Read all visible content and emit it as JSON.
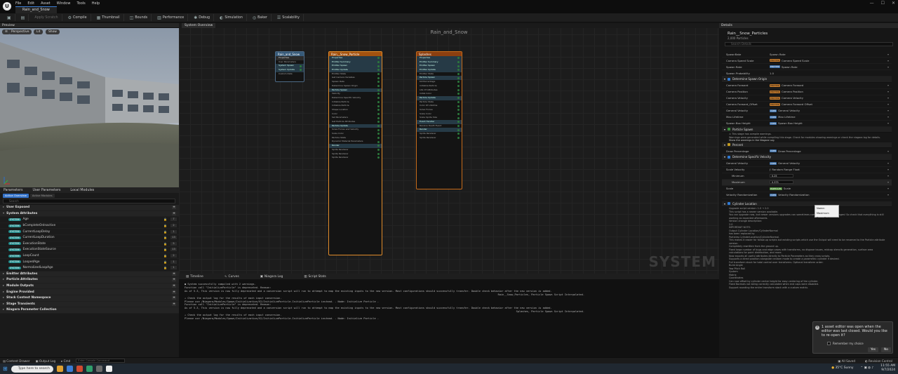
{
  "titlebar": {
    "menu": [
      "File",
      "Edit",
      "Asset",
      "Window",
      "Tools",
      "Help"
    ],
    "tab": "Rain_and_Snow",
    "window_controls": [
      "—",
      "☐",
      "✕"
    ]
  },
  "toolbar": {
    "apply": "Apply Scratch",
    "compile": "Compile",
    "thumbnail": "Thumbnail",
    "bounds": "Bounds",
    "performance": "Performance",
    "debug": "Debug",
    "simulation": "Simulation",
    "baker": "Baker",
    "scalability": "Scalability"
  },
  "preview": {
    "title": "Preview",
    "perspective": "Perspective",
    "lit": "Lit",
    "show": "Show"
  },
  "parameters": {
    "tabs": [
      "Parameters",
      "User Parameters",
      "Local Modules"
    ],
    "subtabs": [
      "Active Overview",
      "Active Modules"
    ],
    "search_placeholder": "Search",
    "user_exposed": "User Exposed",
    "system_attributes": "System Attributes",
    "system_pill": "SYSTEM",
    "attrs": [
      {
        "name": "Age",
        "count": "7"
      },
      {
        "name": "bCompleteOnInactive",
        "count": "2"
      },
      {
        "name": "CurrentLoopDelay",
        "count": "1"
      },
      {
        "name": "CurrentLoopDuration",
        "count": "13"
      },
      {
        "name": "ExecutionState",
        "count": "5"
      },
      {
        "name": "ExecutionStateSource",
        "count": "13"
      },
      {
        "name": "LoopCount",
        "count": "2"
      },
      {
        "name": "LoopedAge",
        "count": "1"
      },
      {
        "name": "NormalizedLoopAge",
        "count": "1"
      }
    ],
    "categories": [
      "Emitter Attributes",
      "Particle Attributes",
      "Module Outputs",
      "Engine Provided",
      "Stack Context Namespace",
      "Stage Transients",
      "Niagara Parameter Collection"
    ]
  },
  "graph": {
    "tab": "System Overview",
    "title": "Rain_and_Snow",
    "watermark": "SYSTEM",
    "sys_node": {
      "title": "Rain_and_Snow",
      "rows": [
        "Properties",
        "User Parameters",
        "System Spawn",
        "System Update",
        "Custom Data"
      ]
    },
    "rain_node": {
      "title": "Rain__Snow_Particle",
      "rows": [
        "Properties",
        "Emitter Summary",
        "Emitter Spawn",
        "Emitter Update",
        "Emitter State",
        "Get Camera Variables",
        "Spawn Rate",
        "Determine Spawn Origin",
        "Particle Spawn",
        "Velocity",
        "Determine Specific Velocity",
        "Initialize Particle",
        "Initialize Particle",
        "Shape Location",
        "Color",
        "Set Parameters",
        "Get Particle Attributes",
        "Particle Update",
        "Solve Forces and Velocity",
        "Scale Color",
        "Particle State",
        "Dynamic Material Parameters",
        "Render",
        "Sprite Renderer",
        "Sprite Renderer",
        "Sprite Renderer"
      ]
    },
    "splash_node": {
      "title": "Splashes",
      "rows": [
        "Properties",
        "Emitter Summary",
        "Emitter Spawn",
        "Emitter Update",
        "Emitter State",
        "Particle Spawn",
        "Kill Percentage",
        "Initialize Particle",
        "Life Of Attributes",
        "Initial Color",
        "Particle Update",
        "Particle State",
        "Color Of Lifetime",
        "Solve Forces",
        "Scale Color",
        "Scale Sprite Size",
        "Event Handler",
        "Receive Death Event",
        "Render",
        "Sprite Renderer",
        "Sprite Renderer"
      ]
    }
  },
  "bottom": {
    "tabs": [
      "Timeline",
      "Curves",
      "Niagara Log",
      "Script Stats"
    ],
    "log": [
      "● System successfully compiled with 2 warnings.",
      "  Function call \"InitializeParticle\" is deprecated. Reason:",
      "  As of 5.3, This version is now fully deprecated and a conversion script will run to attempt to map the existing inputs to the new version. Most configurations should successfully transfer. Double check behavior after the new version is added.",
      "Rain__Snow_Particles, Particle Spawn Script Interpolated.",
      "⚠ Check the output log for the results of each input conversion.",
      "  Please use /Niagara/Modules/Spawn/Initialization/V2/InitializeParticle.InitializeParticle instead. - Node: Initialize Particle -",
      "  Function call \"InitializeParticle\" is deprecated. Reason:",
      "  As of 5.3, This version is now fully deprecated and a conversion script will run to attempt to map the existing inputs to the new version. Most configurations should successfully transfer. Double check behavior after the new version is added.",
      "Splashes, Particle Spawn Script Interpolated.",
      "⚠ Check the output log for the results of each input conversion.",
      "  Please use /Niagara/Modules/Spawn/Initialization/V2/InitializeParticle.InitializeParticle instead. - Node: Initialize Particle -"
    ]
  },
  "details": {
    "tab": "Details",
    "title": "Rain__Snow_Particles",
    "count": "2,000 Particles",
    "search_placeholder": "Search Details",
    "spawn_rate_rows": [
      {
        "label": "SpawnRate",
        "pill": "",
        "value": "Spawn Rate"
      },
      {
        "label": "Camera Speed Scale",
        "pill": "EMITTER",
        "value": "Camera Speed Scale"
      },
      {
        "label": "Spawn Rate",
        "pill": "EMITTER",
        "value": "Spawn Rate"
      },
      {
        "label": "Spawn Probability",
        "pill": "",
        "value": "1.0"
      }
    ],
    "origin_section": "Determine Spawn Origin",
    "origin_rows": [
      {
        "label": "Camera Forward",
        "value": "Camera Forward"
      },
      {
        "label": "Camera Position",
        "value": "Camera Position"
      },
      {
        "label": "Camera Velocity",
        "value": "Camera Velocity"
      },
      {
        "label": "Camera Forward_Offset",
        "value": "Camera Forward Offset"
      },
      {
        "label": "General Velocity",
        "value": "General Velocity"
      },
      {
        "label": "Max Lifetime",
        "value": "Max Lifetime"
      },
      {
        "label": "Spawn Box Height",
        "value": "Spawn Box Height"
      }
    ],
    "particle_spawn": "Particle Spawn",
    "warn_text_1": "This stage has compile warnings.",
    "warn_text_2": "Warnings were generated while compiling this stage. Check for modules showing warnings or check the niagara log for details.",
    "warn_link": "Show the warnings in the Niagara Log",
    "percent_section": "Percent",
    "percent_row": {
      "label": "Draw Percentage",
      "value": "Draw Percentage"
    },
    "velocity_section": "Determine Specific Velocity",
    "velocity_rows": [
      {
        "label": "General Velocity",
        "value": "General Velocity"
      },
      {
        "label": "Scale Velocity",
        "value": "Random Range Float"
      },
      {
        "label": "Minimum",
        "value": "0.25"
      },
      {
        "label": "Maximum",
        "value": "0.375"
      },
      {
        "label": "Scale",
        "value": "Scale"
      },
      {
        "label": "Velocity Randomization",
        "value": "Velocity Randomization"
      }
    ],
    "tooltip_name": "Name: Maximum",
    "tooltip_type": "Type: float",
    "cylinder_section": "Cylinder Location",
    "cylinder_text": [
      "Upgrade script version: 1.0 → 2.0",
      "This script has a newer version available.",
      "You can upgrade now, but newer versions upgrades can sometimes come with breaking changes! So check that everything is still working as expected afterwards.",
      "Version change description:",
      "2.0",
      "IMPORTANT NOTE:",
      "Output Cylinder Location/CylinderNormal",
      "has been replaced by",
      "Particles.CylinderLocation/CylinderNormal.",
      "This makes it easier for follow-up scripts but existing scripts which use the Output will need to be renamed to the Particle attribute version.",
      "Completely rewritten from the ground up.",
      "Fixed large number of bugs and edge cases with transforms, no dispose issues, midcap stencils generation, surface area calculations for point distribution, and more.",
      "Now exports all useful attributes directly to Particle Parameters as they cross scripts.",
      "Supports a direct position alongside random mode to create a parametric cylinder if desired.",
      "Full transform stack for total control over transforms. Optional transform order:",
      "Burst Angle",
      "Yaw Pitch Roll",
      "System",
      "Matrix",
      "Coordinates",
      "Can now offset by cylinder center height for easy centering of the cylinder.",
      "Fixed Normals not being correctly calculated when end caps were disabled.",
      "Support rounding the entire transform stack with a custom matrix."
    ]
  },
  "toast": {
    "message": "1 asset editor was open when the editor was last closed. Would you like to re-open it?",
    "remember": "Remember my choice",
    "yes": "Yes",
    "no": "No"
  },
  "status": {
    "content_drawer": "Content Drawer",
    "output_log": "Output Log",
    "cmd": "Cmd",
    "cmd_placeholder": "Enter Console Command",
    "all_saved": "All Saved",
    "revision": "Revision Control"
  },
  "taskbar": {
    "search": "Type here to search",
    "weather": "35°C  Sunny",
    "time": "11:55 AM",
    "date": "9/7/2024"
  }
}
